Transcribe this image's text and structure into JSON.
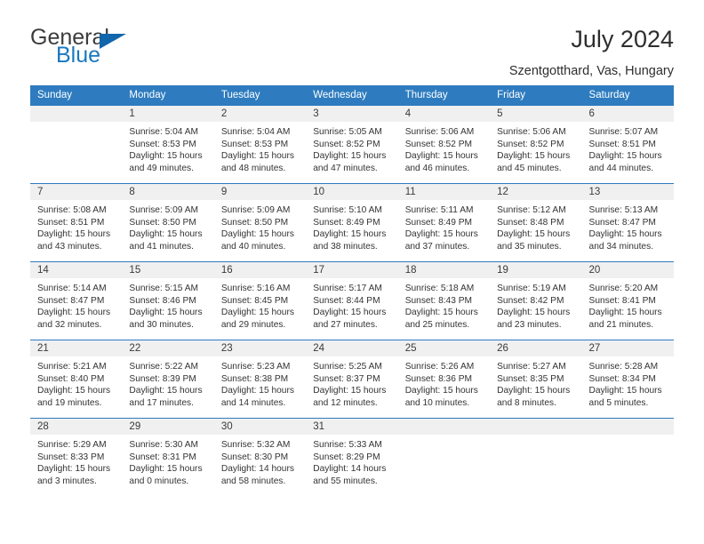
{
  "brand": {
    "name_top": "General",
    "name_bottom": "Blue",
    "triangle_color": "#1266ab",
    "blue_color": "#1878be"
  },
  "header": {
    "title": "July 2024",
    "subtitle": "Szentgotthard, Vas, Hungary"
  },
  "colors": {
    "header_blue": "#2e7cbf",
    "daynum_bg": "#f0f0f0",
    "text": "#333333"
  },
  "weekday_headers": [
    "Sunday",
    "Monday",
    "Tuesday",
    "Wednesday",
    "Thursday",
    "Friday",
    "Saturday"
  ],
  "weeks": [
    [
      {
        "day": "",
        "lines": []
      },
      {
        "day": "1",
        "lines": [
          "Sunrise: 5:04 AM",
          "Sunset: 8:53 PM",
          "Daylight: 15 hours",
          "and 49 minutes."
        ]
      },
      {
        "day": "2",
        "lines": [
          "Sunrise: 5:04 AM",
          "Sunset: 8:53 PM",
          "Daylight: 15 hours",
          "and 48 minutes."
        ]
      },
      {
        "day": "3",
        "lines": [
          "Sunrise: 5:05 AM",
          "Sunset: 8:52 PM",
          "Daylight: 15 hours",
          "and 47 minutes."
        ]
      },
      {
        "day": "4",
        "lines": [
          "Sunrise: 5:06 AM",
          "Sunset: 8:52 PM",
          "Daylight: 15 hours",
          "and 46 minutes."
        ]
      },
      {
        "day": "5",
        "lines": [
          "Sunrise: 5:06 AM",
          "Sunset: 8:52 PM",
          "Daylight: 15 hours",
          "and 45 minutes."
        ]
      },
      {
        "day": "6",
        "lines": [
          "Sunrise: 5:07 AM",
          "Sunset: 8:51 PM",
          "Daylight: 15 hours",
          "and 44 minutes."
        ]
      }
    ],
    [
      {
        "day": "7",
        "lines": [
          "Sunrise: 5:08 AM",
          "Sunset: 8:51 PM",
          "Daylight: 15 hours",
          "and 43 minutes."
        ]
      },
      {
        "day": "8",
        "lines": [
          "Sunrise: 5:09 AM",
          "Sunset: 8:50 PM",
          "Daylight: 15 hours",
          "and 41 minutes."
        ]
      },
      {
        "day": "9",
        "lines": [
          "Sunrise: 5:09 AM",
          "Sunset: 8:50 PM",
          "Daylight: 15 hours",
          "and 40 minutes."
        ]
      },
      {
        "day": "10",
        "lines": [
          "Sunrise: 5:10 AM",
          "Sunset: 8:49 PM",
          "Daylight: 15 hours",
          "and 38 minutes."
        ]
      },
      {
        "day": "11",
        "lines": [
          "Sunrise: 5:11 AM",
          "Sunset: 8:49 PM",
          "Daylight: 15 hours",
          "and 37 minutes."
        ]
      },
      {
        "day": "12",
        "lines": [
          "Sunrise: 5:12 AM",
          "Sunset: 8:48 PM",
          "Daylight: 15 hours",
          "and 35 minutes."
        ]
      },
      {
        "day": "13",
        "lines": [
          "Sunrise: 5:13 AM",
          "Sunset: 8:47 PM",
          "Daylight: 15 hours",
          "and 34 minutes."
        ]
      }
    ],
    [
      {
        "day": "14",
        "lines": [
          "Sunrise: 5:14 AM",
          "Sunset: 8:47 PM",
          "Daylight: 15 hours",
          "and 32 minutes."
        ]
      },
      {
        "day": "15",
        "lines": [
          "Sunrise: 5:15 AM",
          "Sunset: 8:46 PM",
          "Daylight: 15 hours",
          "and 30 minutes."
        ]
      },
      {
        "day": "16",
        "lines": [
          "Sunrise: 5:16 AM",
          "Sunset: 8:45 PM",
          "Daylight: 15 hours",
          "and 29 minutes."
        ]
      },
      {
        "day": "17",
        "lines": [
          "Sunrise: 5:17 AM",
          "Sunset: 8:44 PM",
          "Daylight: 15 hours",
          "and 27 minutes."
        ]
      },
      {
        "day": "18",
        "lines": [
          "Sunrise: 5:18 AM",
          "Sunset: 8:43 PM",
          "Daylight: 15 hours",
          "and 25 minutes."
        ]
      },
      {
        "day": "19",
        "lines": [
          "Sunrise: 5:19 AM",
          "Sunset: 8:42 PM",
          "Daylight: 15 hours",
          "and 23 minutes."
        ]
      },
      {
        "day": "20",
        "lines": [
          "Sunrise: 5:20 AM",
          "Sunset: 8:41 PM",
          "Daylight: 15 hours",
          "and 21 minutes."
        ]
      }
    ],
    [
      {
        "day": "21",
        "lines": [
          "Sunrise: 5:21 AM",
          "Sunset: 8:40 PM",
          "Daylight: 15 hours",
          "and 19 minutes."
        ]
      },
      {
        "day": "22",
        "lines": [
          "Sunrise: 5:22 AM",
          "Sunset: 8:39 PM",
          "Daylight: 15 hours",
          "and 17 minutes."
        ]
      },
      {
        "day": "23",
        "lines": [
          "Sunrise: 5:23 AM",
          "Sunset: 8:38 PM",
          "Daylight: 15 hours",
          "and 14 minutes."
        ]
      },
      {
        "day": "24",
        "lines": [
          "Sunrise: 5:25 AM",
          "Sunset: 8:37 PM",
          "Daylight: 15 hours",
          "and 12 minutes."
        ]
      },
      {
        "day": "25",
        "lines": [
          "Sunrise: 5:26 AM",
          "Sunset: 8:36 PM",
          "Daylight: 15 hours",
          "and 10 minutes."
        ]
      },
      {
        "day": "26",
        "lines": [
          "Sunrise: 5:27 AM",
          "Sunset: 8:35 PM",
          "Daylight: 15 hours",
          "and 8 minutes."
        ]
      },
      {
        "day": "27",
        "lines": [
          "Sunrise: 5:28 AM",
          "Sunset: 8:34 PM",
          "Daylight: 15 hours",
          "and 5 minutes."
        ]
      }
    ],
    [
      {
        "day": "28",
        "lines": [
          "Sunrise: 5:29 AM",
          "Sunset: 8:33 PM",
          "Daylight: 15 hours",
          "and 3 minutes."
        ]
      },
      {
        "day": "29",
        "lines": [
          "Sunrise: 5:30 AM",
          "Sunset: 8:31 PM",
          "Daylight: 15 hours",
          "and 0 minutes."
        ]
      },
      {
        "day": "30",
        "lines": [
          "Sunrise: 5:32 AM",
          "Sunset: 8:30 PM",
          "Daylight: 14 hours",
          "and 58 minutes."
        ]
      },
      {
        "day": "31",
        "lines": [
          "Sunrise: 5:33 AM",
          "Sunset: 8:29 PM",
          "Daylight: 14 hours",
          "and 55 minutes."
        ]
      },
      {
        "day": "",
        "lines": []
      },
      {
        "day": "",
        "lines": []
      },
      {
        "day": "",
        "lines": []
      }
    ]
  ]
}
